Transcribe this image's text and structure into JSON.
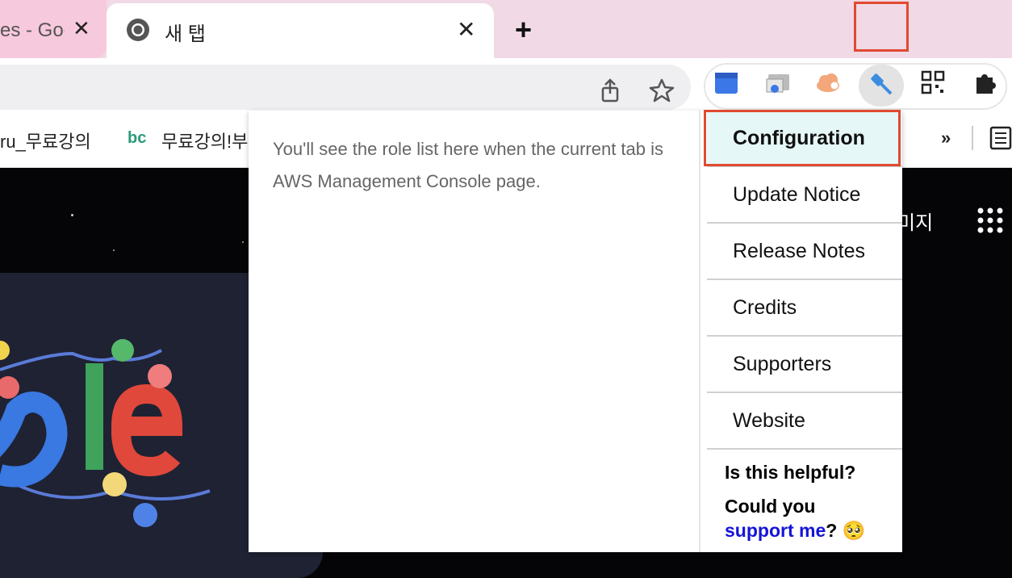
{
  "tabs": [
    {
      "title": "es - Goo",
      "close": "✕"
    },
    {
      "title": "새 탭",
      "close": "✕"
    }
  ],
  "new_tab_label": "+",
  "toolbar": {
    "share_icon": "share-icon",
    "bookmark_star_icon": "star-icon",
    "extensions": [
      "calendar-extension",
      "cast-extension",
      "cloud-extension",
      "aws-role-key-extension",
      "qr-code-extension",
      "puzzle-extensions-icon"
    ]
  },
  "bookmarks": {
    "items": [
      {
        "label": "ru_무료강의",
        "icon": ""
      },
      {
        "label": "무료강의!부",
        "icon": "bc"
      }
    ],
    "overflow": "»"
  },
  "page": {
    "right_label": "미지"
  },
  "popup": {
    "message": "You'll see the role list here when the current tab is AWS Management Console page.",
    "menu": [
      "Configuration",
      "Update Notice",
      "Release Notes",
      "Credits",
      "Supporters",
      "Website"
    ],
    "help_line1": "Is this helpful?",
    "help_line2": "Could you",
    "help_link": "support me",
    "help_suffix": "? 🥺"
  },
  "colors": {
    "highlight_border": "#e04a30",
    "active_menu_bg": "#e6f7f7",
    "link": "#1414d8"
  }
}
